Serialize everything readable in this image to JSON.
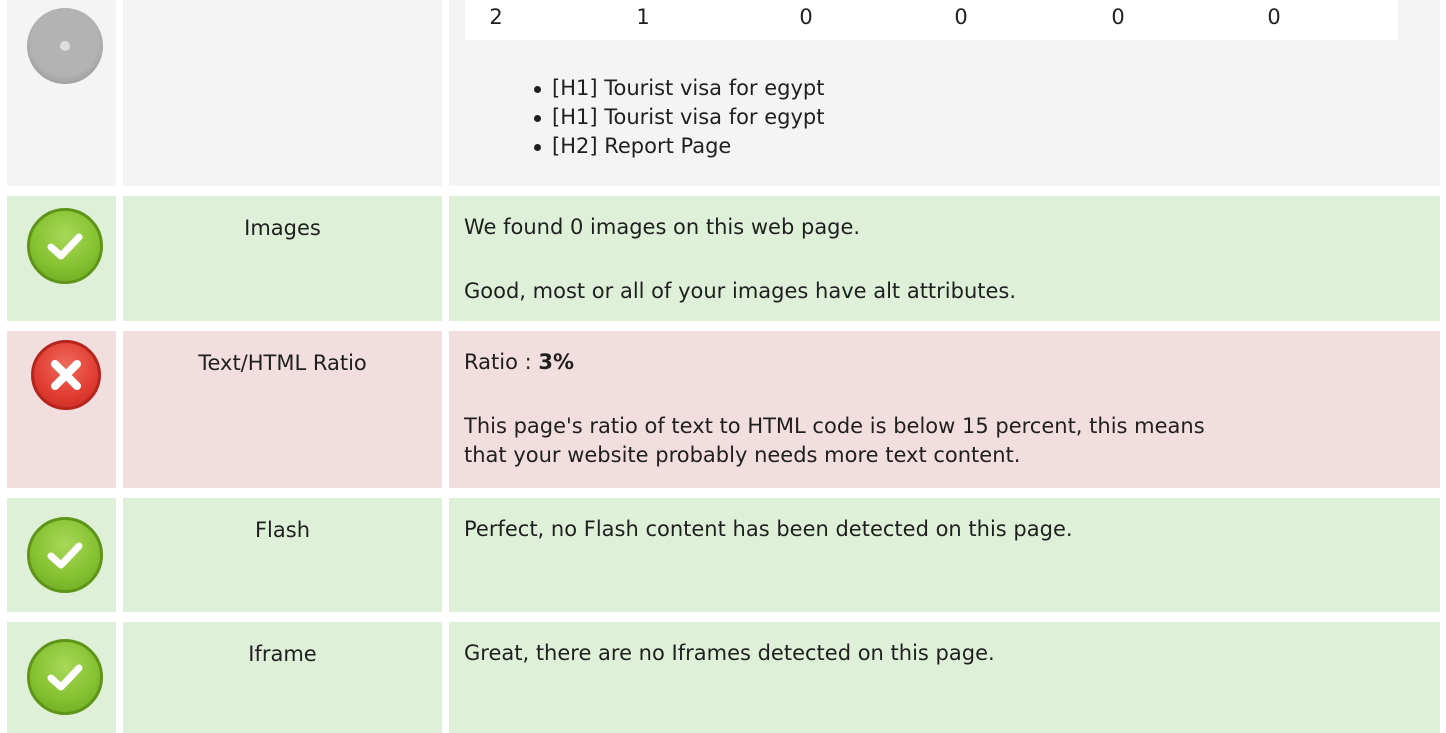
{
  "headings": {
    "counts": [
      "2",
      "1",
      "0",
      "0",
      "0",
      "0"
    ],
    "items": [
      "[H1] Tourist visa for egypt",
      "[H1] Tourist visa for egypt",
      "[H2] Report Page"
    ]
  },
  "images": {
    "label": "Images",
    "line1": "We found 0 images on this web page.",
    "line2": "Good, most or all of your images have alt attributes."
  },
  "ratio": {
    "label": "Text/HTML Ratio",
    "prefix": "Ratio : ",
    "value": "3%",
    "line2a": "This page's ratio of text to HTML code is below 15 percent, this means",
    "line2b": "that your website probably needs more text content."
  },
  "flash": {
    "label": "Flash",
    "line1": "Perfect, no Flash content has been detected on this page."
  },
  "iframe": {
    "label": "Iframe",
    "line1": "Great, there are no Iframes detected on this page."
  },
  "colors": {
    "neutral_bg": "#f4f4f4",
    "ok_bg": "#dff0d8",
    "error_bg": "#f2dede",
    "ok_icon": "#86c232",
    "error_icon": "#e03c31"
  },
  "icons": {
    "neutral": "neutral-status-icon",
    "ok": "check-icon",
    "error": "cross-icon"
  }
}
